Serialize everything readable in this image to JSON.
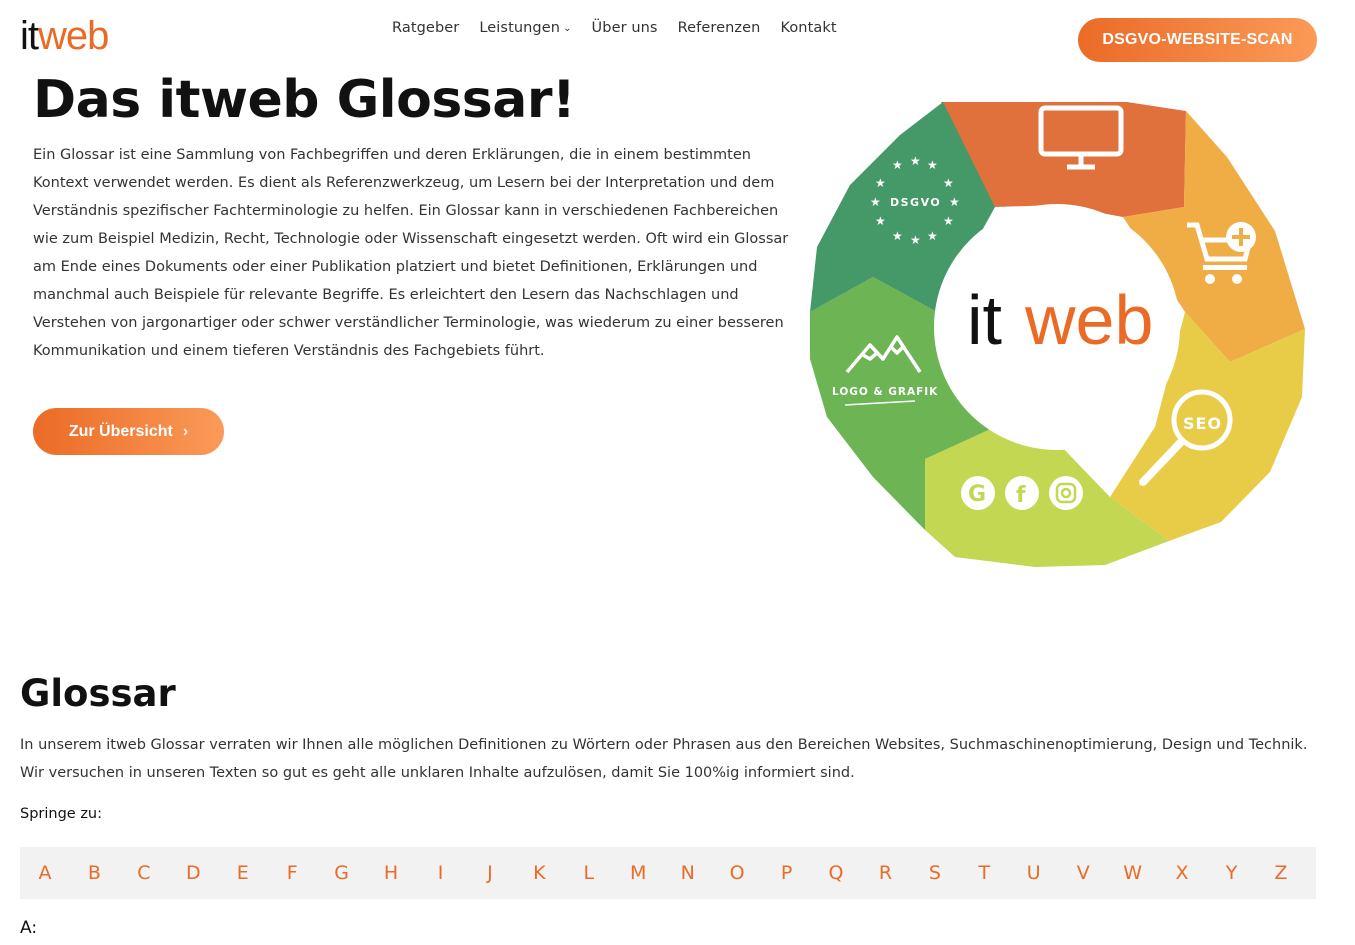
{
  "header": {
    "logo_it": "it",
    "logo_web": "web",
    "nav": [
      {
        "label": "Ratgeber"
      },
      {
        "label": "Leistungen"
      },
      {
        "label": "Über uns"
      },
      {
        "label": "Referenzen"
      },
      {
        "label": "Kontakt"
      }
    ],
    "cta_label": "DSGVO-WEBSITE-SCAN"
  },
  "hero": {
    "title": "Das itweb Glossar!",
    "text": "Ein Glossar ist eine Sammlung von Fachbegriffen und deren Erklärungen, die in einem bestimmten Kontext verwendet werden. Es dient als Referenzwerkzeug, um Lesern bei der Interpretation und dem Verständnis spezifischer Fachterminologie zu helfen. Ein Glossar kann in verschiedenen Fachbereichen wie zum Beispiel Medizin, Recht, Technologie oder Wissenschaft eingesetzt werden. Oft wird ein Glossar am Ende eines Dokuments oder einer Publikation platziert und bietet Definitionen, Erklärungen und manchmal auch Beispiele für relevante Begriffe. Es erleichtert den Lesern das Nachschlagen und Verstehen von jargonartiger oder schwer verständlicher Terminologie, was wiederum zu einer besseren Kommunikation und einem tieferen Verständnis des Fachgebiets führt.",
    "button_label": "Zur Übersicht",
    "button_arrow": "›"
  },
  "wheel": {
    "center_it": "it",
    "center_web": "web",
    "dsgvo_label": "DSGVO",
    "logo_label": "LOGO & GRAFIK",
    "seo_label": "SEO",
    "colors": {
      "orange": "#e0703c",
      "amber": "#f0ad45",
      "yellow": "#e8cc48",
      "lime": "#c3d752",
      "green": "#6db455",
      "teal": "#459868"
    }
  },
  "glossar": {
    "title": "Glossar",
    "text": "In unserem itweb Glossar verraten wir Ihnen alle möglichen Definitionen zu Wörtern oder Phrasen aus den Bereichen Websites, Suchmaschinenoptimierung, Design und Technik. Wir versuchen in unseren Texten so gut es geht alle unklaren Inhalte aufzulösen, damit Sie 100%ig informiert sind.",
    "jump_label": "Springe zu:",
    "letters": [
      "A",
      "B",
      "C",
      "D",
      "E",
      "F",
      "G",
      "H",
      "I",
      "J",
      "K",
      "L",
      "M",
      "N",
      "O",
      "P",
      "Q",
      "R",
      "S",
      "T",
      "U",
      "V",
      "W",
      "X",
      "Y",
      "Z"
    ],
    "section_a": "A:"
  },
  "accent": "#ea6b26"
}
